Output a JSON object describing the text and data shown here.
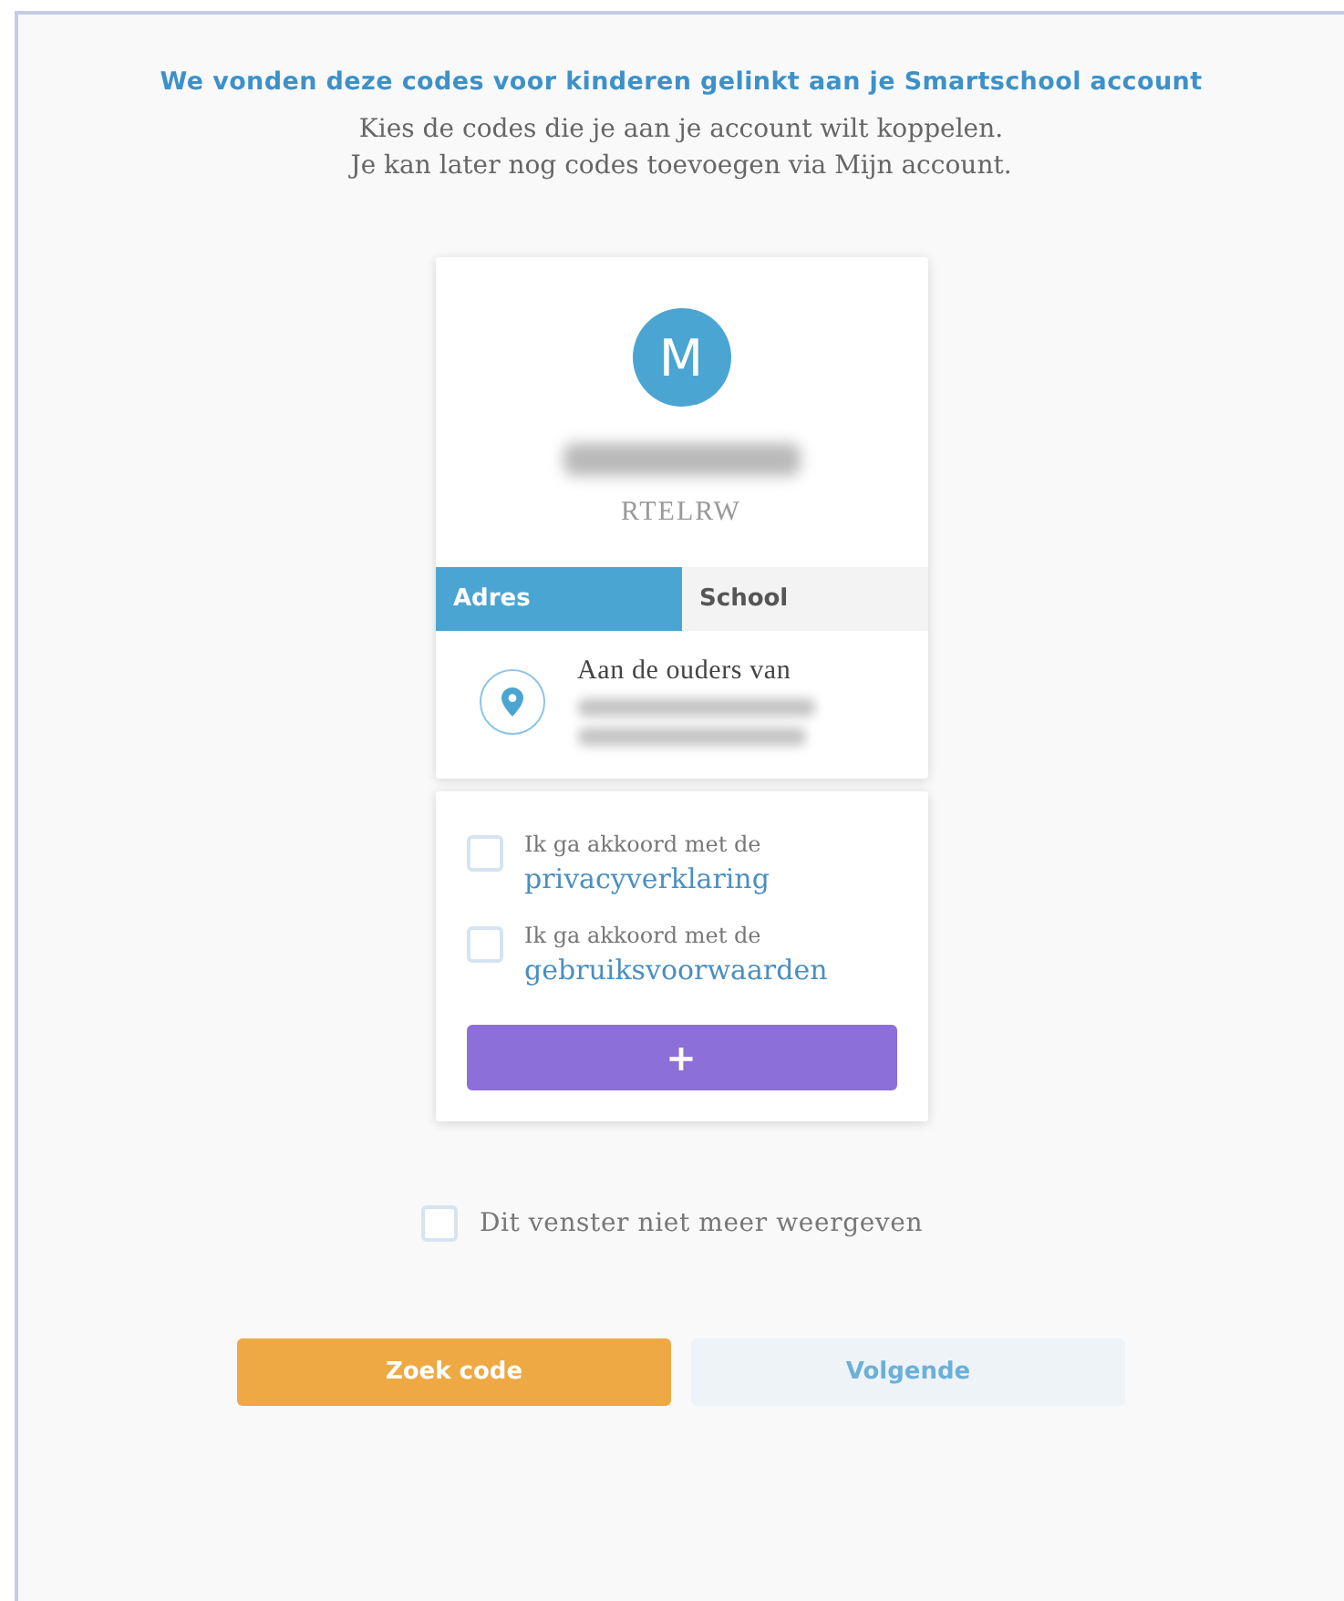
{
  "heading": "We vonden deze codes voor kinderen gelinkt aan je Smartschool account",
  "intro": [
    "Kies de codes die je aan je account wilt koppelen.",
    "Je kan later nog codes toevoegen via Mijn account."
  ],
  "child": {
    "avatar_letter": "M",
    "code": "RTELRW",
    "tabs": [
      {
        "label": "Adres",
        "selected": true
      },
      {
        "label": "School",
        "selected": false
      }
    ],
    "address_line": "Aan de ouders van"
  },
  "consents": [
    {
      "text": "Ik ga akkoord met de",
      "link": "privacyverklaring",
      "checked": false
    },
    {
      "text": "Ik ga akkoord met de",
      "link": "gebruiksvoorwaarden",
      "checked": false
    }
  ],
  "add_button": "+",
  "hide_option": {
    "label": "Dit venster niet meer weergeven",
    "checked": false
  },
  "buttons": [
    {
      "label": "Zoek code",
      "kind": "primary"
    },
    {
      "label": "Volgende",
      "kind": "secondary"
    }
  ]
}
